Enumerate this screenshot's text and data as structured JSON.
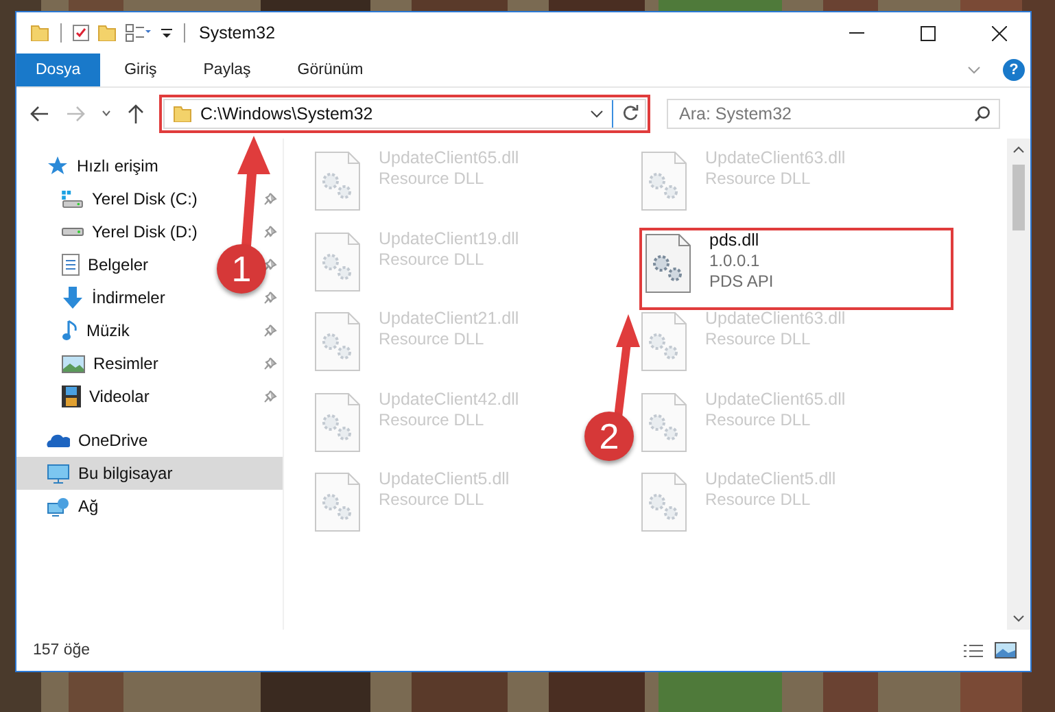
{
  "window": {
    "title": "System32"
  },
  "ribbon": {
    "tabs": [
      {
        "label": "Dosya",
        "selected": true
      },
      {
        "label": "Giriş",
        "selected": false
      },
      {
        "label": "Paylaş",
        "selected": false
      },
      {
        "label": "Görünüm",
        "selected": false
      }
    ],
    "help": "?"
  },
  "address": {
    "path": "C:\\Windows\\System32",
    "highlighted": true
  },
  "search": {
    "placeholder": "Ara: System32"
  },
  "sidebar": {
    "items": [
      {
        "label": "Hızlı erişim",
        "selected": false,
        "children": [
          {
            "label": "Yerel Disk (C:)",
            "pinned": true
          },
          {
            "label": "Yerel Disk (D:)",
            "pinned": true
          },
          {
            "label": "Belgeler",
            "pinned": true
          },
          {
            "label": "İndirmeler",
            "pinned": true
          },
          {
            "label": "Müzik",
            "pinned": true
          },
          {
            "label": "Resimler",
            "pinned": true
          },
          {
            "label": "Videolar",
            "pinned": true
          }
        ]
      },
      {
        "label": "OneDrive",
        "selected": false
      },
      {
        "label": "Bu bilgisayar",
        "selected": true
      },
      {
        "label": "Ağ",
        "selected": false
      }
    ]
  },
  "files": [
    {
      "name": "UpdateClient65.dll",
      "lines": [
        "Resource DLL"
      ],
      "dimmed": true,
      "highlighted": false
    },
    {
      "name": "UpdateClient63.dll",
      "lines": [
        "Resource DLL"
      ],
      "dimmed": true,
      "highlighted": false
    },
    {
      "name": "UpdateClient19.dll",
      "lines": [
        "Resource DLL"
      ],
      "dimmed": true,
      "highlighted": false
    },
    {
      "name": "pds.dll",
      "lines": [
        "1.0.0.1",
        "PDS API"
      ],
      "dimmed": false,
      "highlighted": true
    },
    {
      "name": "UpdateClient21.dll",
      "lines": [
        "Resource DLL"
      ],
      "dimmed": true,
      "highlighted": false
    },
    {
      "name": "UpdateClient63.dll",
      "lines": [
        "Resource DLL"
      ],
      "dimmed": true,
      "highlighted": false
    },
    {
      "name": "UpdateClient42.dll",
      "lines": [
        "Resource DLL"
      ],
      "dimmed": true,
      "highlighted": false
    },
    {
      "name": "UpdateClient65.dll",
      "lines": [
        "Resource DLL"
      ],
      "dimmed": true,
      "highlighted": false
    },
    {
      "name": "UpdateClient5.dll",
      "lines": [
        "Resource DLL"
      ],
      "dimmed": true,
      "highlighted": false
    },
    {
      "name": "UpdateClient5.dll",
      "lines": [
        "Resource DLL"
      ],
      "dimmed": true,
      "highlighted": false
    }
  ],
  "status_bar": {
    "count": "157 öğe"
  },
  "annotations": [
    {
      "label": "1"
    },
    {
      "label": "2"
    }
  ]
}
